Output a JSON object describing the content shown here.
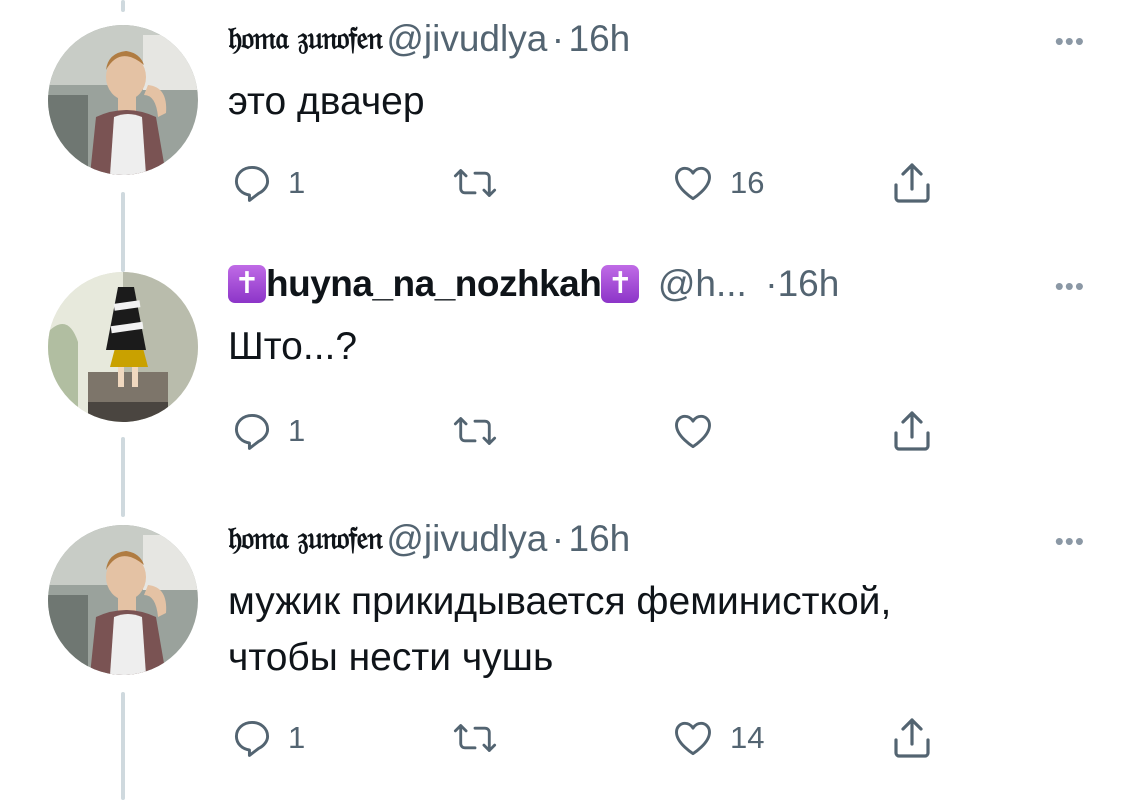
{
  "tweets": [
    {
      "name": "𝔥𝔬𝔪𝔞 𝔷𝔲𝔫𝔬𝔣𝔢𝔫",
      "handle": "@jivudlya",
      "separator": "·",
      "time": "16h",
      "more": "•••",
      "text": "это двачер",
      "reply_count": "1",
      "retweet_count": "",
      "like_count": "16"
    },
    {
      "badge_left": "✝",
      "name": "huyna_na_nozhkah",
      "badge_right": "✝",
      "handle": "@h...",
      "separator": "·",
      "time": "16h",
      "more": "•••",
      "text": "Што...?",
      "reply_count": "1",
      "retweet_count": "",
      "like_count": ""
    },
    {
      "name": "𝔥𝔬𝔪𝔞 𝔷𝔲𝔫𝔬𝔣𝔢𝔫",
      "handle": "@jivudlya",
      "separator": "·",
      "time": "16h",
      "more": "•••",
      "text_line1": "мужик прикидывается феминисткой,",
      "text_line2": "чтобы нести чушь",
      "reply_count": "1",
      "retweet_count": "",
      "like_count": "14"
    }
  ],
  "colors": {
    "text": "#0f1419",
    "secondary": "#536471",
    "thread_line": "#cfd9de",
    "badge": "#9b45d4"
  },
  "icons": [
    "reply-icon",
    "retweet-icon",
    "like-icon",
    "share-icon",
    "more-icon"
  ]
}
